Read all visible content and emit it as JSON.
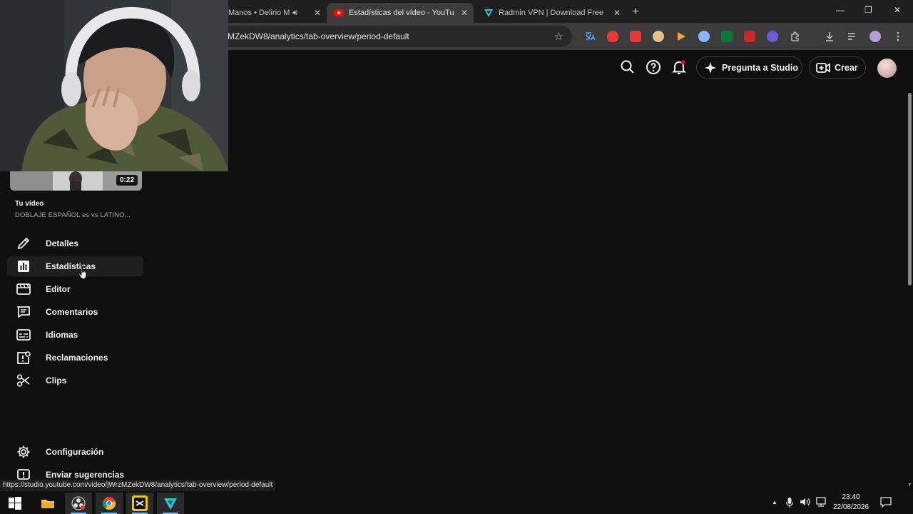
{
  "browser": {
    "tabs": [
      {
        "title": "Manos • Delirio M",
        "favicon": "speaker-icon",
        "active": false
      },
      {
        "title": "Estadísticas del vídeo - YouTube",
        "favicon": "youtube-studio-icon",
        "active": true
      },
      {
        "title": "Radmin VPN | Download Free V",
        "favicon": "radmin-vpn-icon",
        "active": false
      }
    ],
    "new_tab_symbol": "+",
    "window_controls": {
      "minimize": "—",
      "restore": "❐",
      "close": "✕"
    },
    "tab_close_symbol": "✕",
    "url": "MZekDW8/analytics/tab-overview/period-default",
    "star_symbol": "☆",
    "status_url": "https://studio.youtube.com/video/jWrzMZekDW8/analytics/tab-overview/period-default"
  },
  "studio_header": {
    "ask_studio_label": "Pregunta a Studio",
    "create_label": "Crear"
  },
  "sidebar": {
    "video_duration": "0:22",
    "your_video_label": "Tu vídeo",
    "video_title": "DOBLAJE ESPAÑOL es vs LATINO...",
    "items": [
      {
        "label": "Detalles",
        "icon": "pencil-icon",
        "selected": false
      },
      {
        "label": "Estadísticas",
        "icon": "analytics-icon",
        "selected": true
      },
      {
        "label": "Editor",
        "icon": "film-editor-icon",
        "selected": false
      },
      {
        "label": "Comentarios",
        "icon": "comment-icon",
        "selected": false
      },
      {
        "label": "Idiomas",
        "icon": "subtitles-icon",
        "selected": false
      },
      {
        "label": "Reclamaciones",
        "icon": "copyright-claim-icon",
        "selected": false
      },
      {
        "label": "Clips",
        "icon": "scissors-icon",
        "selected": false
      }
    ],
    "bottom_items": [
      {
        "label": "Configuración",
        "icon": "gear-icon"
      },
      {
        "label": "Enviar sugerencias",
        "icon": "feedback-icon"
      }
    ]
  },
  "taskbar": {
    "apps": [
      "start-icon",
      "file-explorer-icon",
      "obs-icon",
      "chrome-icon",
      "capcut-icon",
      "radmin-vpn-icon"
    ],
    "tray_arrow": "▲",
    "time": "23:40",
    "date": "22/08/2026"
  },
  "colors": {
    "page_background": "#0f0f0f",
    "selected_nav": "#1f1f1f",
    "notification_dot": "#ff0033",
    "youtube_red": "#ff0000"
  }
}
